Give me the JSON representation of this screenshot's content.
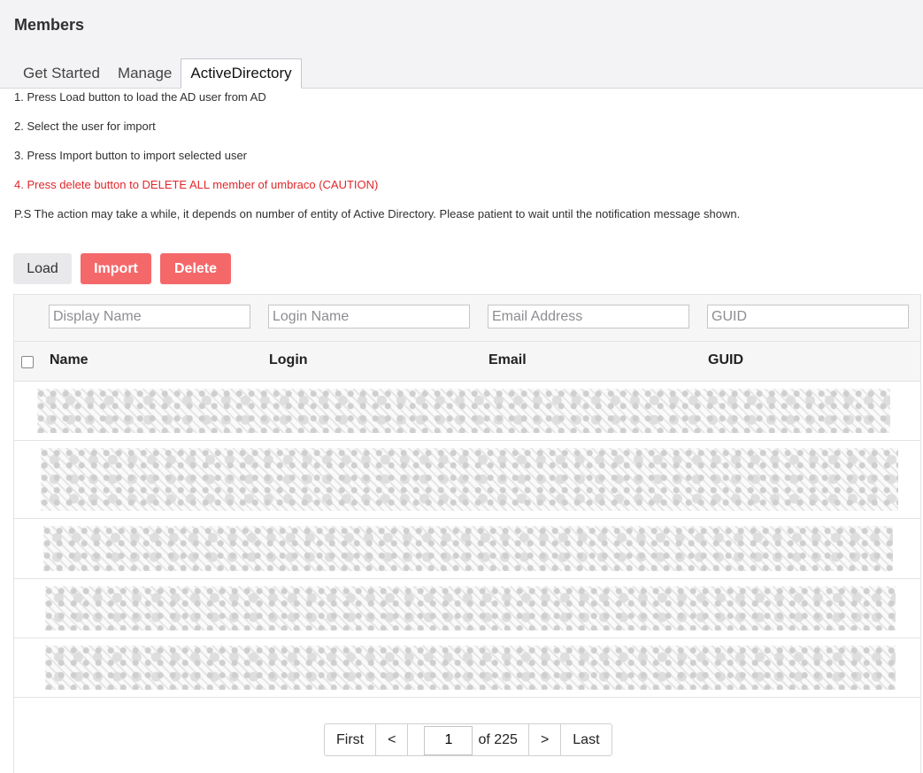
{
  "header": {
    "title": "Members"
  },
  "tabs": [
    {
      "label": "Get Started"
    },
    {
      "label": "Manage"
    },
    {
      "label": "ActiveDirectory"
    }
  ],
  "instructions": {
    "step1": "1. Press Load button to load the AD user from AD",
    "step2": "2. Select the user for import",
    "step3": "3. Press Import button to import selected user",
    "step4": "4. Press delete button to DELETE ALL member of umbraco (CAUTION)",
    "note": "P.S The action may take a while, it depends on number of entity of Active Directory. Please patient to wait until the notification message shown."
  },
  "toolbar": {
    "load_label": "Load",
    "import_label": "Import",
    "delete_label": "Delete",
    "accent_color": "#f4686a"
  },
  "filters": {
    "display_name_placeholder": "Display Name",
    "login_name_placeholder": "Login Name",
    "email_placeholder": "Email Address",
    "guid_placeholder": "GUID"
  },
  "columns": {
    "name": "Name",
    "login": "Login",
    "email": "Email",
    "guid": "GUID"
  },
  "rows_note": "5 rows with redacted content",
  "pagination": {
    "first": "First",
    "prev": "<",
    "current": "1",
    "of": "of 225",
    "next": ">",
    "last": "Last"
  }
}
